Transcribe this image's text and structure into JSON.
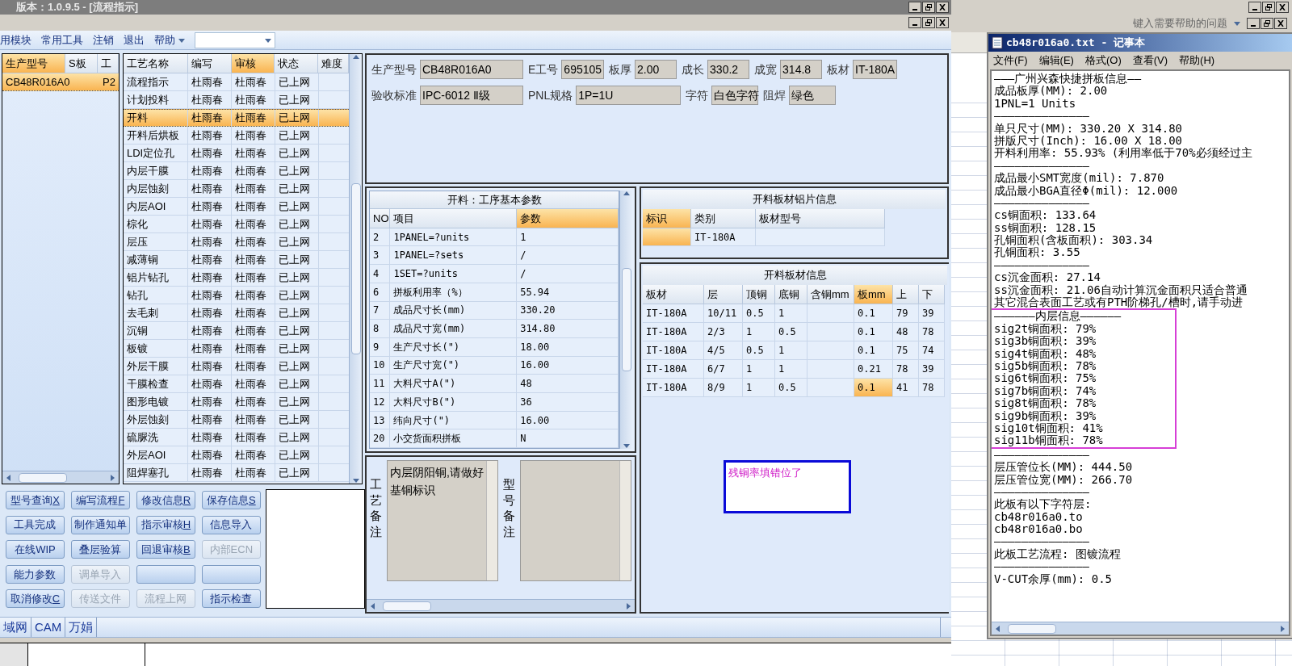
{
  "window": {
    "title": "版本：1.0.9.5 - [流程指示]"
  },
  "menu": [
    {
      "label": "用模块",
      "kind": "item"
    },
    {
      "label": "常用工具",
      "kind": "item"
    },
    {
      "label": "注销",
      "kind": "item"
    },
    {
      "label": "退出",
      "kind": "item"
    },
    {
      "label": "帮助",
      "kind": "dropdown"
    }
  ],
  "model_list": {
    "columns": [
      {
        "label": "生产型号",
        "selected": true
      },
      {
        "label": "S板",
        "selected": false
      },
      {
        "label": "工",
        "selected": false
      }
    ],
    "rows": [
      {
        "cells": [
          "CB48R016A0",
          "",
          "P2"
        ],
        "selected": true
      }
    ]
  },
  "process_table": {
    "columns": [
      {
        "label": "工艺名称",
        "selected": false
      },
      {
        "label": "编写",
        "selected": false
      },
      {
        "label": "审核",
        "selected": true
      },
      {
        "label": "状态",
        "selected": false
      },
      {
        "label": "难度",
        "selected": false
      }
    ],
    "rows": [
      {
        "cells": [
          "流程指示",
          "杜雨春",
          "杜雨春",
          "已上网"
        ],
        "selected": false
      },
      {
        "cells": [
          "计划投料",
          "杜雨春",
          "杜雨春",
          "已上网"
        ],
        "selected": false
      },
      {
        "cells": [
          "开料",
          "杜雨春",
          "杜雨春",
          "已上网"
        ],
        "selected": true
      },
      {
        "cells": [
          "开料后烘板",
          "杜雨春",
          "杜雨春",
          "已上网"
        ],
        "selected": false
      },
      {
        "cells": [
          "LDI定位孔",
          "杜雨春",
          "杜雨春",
          "已上网"
        ],
        "selected": false
      },
      {
        "cells": [
          "内层干膜",
          "杜雨春",
          "杜雨春",
          "已上网"
        ],
        "selected": false
      },
      {
        "cells": [
          "内层蚀刻",
          "杜雨春",
          "杜雨春",
          "已上网"
        ],
        "selected": false
      },
      {
        "cells": [
          "内层AOI",
          "杜雨春",
          "杜雨春",
          "已上网"
        ],
        "selected": false
      },
      {
        "cells": [
          "棕化",
          "杜雨春",
          "杜雨春",
          "已上网"
        ],
        "selected": false
      },
      {
        "cells": [
          "层压",
          "杜雨春",
          "杜雨春",
          "已上网"
        ],
        "selected": false
      },
      {
        "cells": [
          "减薄铜",
          "杜雨春",
          "杜雨春",
          "已上网"
        ],
        "selected": false
      },
      {
        "cells": [
          "铝片钻孔",
          "杜雨春",
          "杜雨春",
          "已上网"
        ],
        "selected": false
      },
      {
        "cells": [
          "钻孔",
          "杜雨春",
          "杜雨春",
          "已上网"
        ],
        "selected": false
      },
      {
        "cells": [
          "去毛刺",
          "杜雨春",
          "杜雨春",
          "已上网"
        ],
        "selected": false
      },
      {
        "cells": [
          "沉铜",
          "杜雨春",
          "杜雨春",
          "已上网"
        ],
        "selected": false
      },
      {
        "cells": [
          "板镀",
          "杜雨春",
          "杜雨春",
          "已上网"
        ],
        "selected": false
      },
      {
        "cells": [
          "外层干膜",
          "杜雨春",
          "杜雨春",
          "已上网"
        ],
        "selected": false
      },
      {
        "cells": [
          "干膜检查",
          "杜雨春",
          "杜雨春",
          "已上网"
        ],
        "selected": false
      },
      {
        "cells": [
          "图形电镀",
          "杜雨春",
          "杜雨春",
          "已上网"
        ],
        "selected": false
      },
      {
        "cells": [
          "外层蚀刻",
          "杜雨春",
          "杜雨春",
          "已上网"
        ],
        "selected": false
      },
      {
        "cells": [
          "硫脲洗",
          "杜雨春",
          "杜雨春",
          "已上网"
        ],
        "selected": false
      },
      {
        "cells": [
          "外层AOI",
          "杜雨春",
          "杜雨春",
          "已上网"
        ],
        "selected": false
      },
      {
        "cells": [
          "阻焊塞孔",
          "杜雨春",
          "杜雨春",
          "已上网"
        ],
        "selected": false
      }
    ]
  },
  "info": {
    "fields_top": [
      {
        "label": "生产型号",
        "value": "CB48R016A0"
      },
      {
        "label": "E工号",
        "value": "695105"
      },
      {
        "label": "板厚",
        "value": "2.00"
      },
      {
        "label": "成长",
        "value": "330.2"
      },
      {
        "label": "成宽",
        "value": "314.8"
      },
      {
        "label": "板材",
        "value": "IT-180A"
      }
    ],
    "fields_bottom": [
      {
        "label": "验收标准",
        "value": "IPC-6012 Ⅱ级"
      },
      {
        "label": "PNL规格",
        "value": "1P=1U"
      },
      {
        "label": "字符",
        "value": "白色字符"
      },
      {
        "label": "阻焊",
        "value": "绿色"
      }
    ]
  },
  "params": {
    "title": "开料：工序基本参数",
    "columns": [
      {
        "label": "NO",
        "selected": false
      },
      {
        "label": "项目",
        "selected": false
      },
      {
        "label": "参数",
        "selected": true
      }
    ],
    "rows": [
      [
        "2",
        "1PANEL=?units",
        "1"
      ],
      [
        "3",
        "1PANEL=?sets",
        "/"
      ],
      [
        "4",
        "1SET=?units",
        "/"
      ],
      [
        "6",
        "拼板利用率（%）",
        "55.94"
      ],
      [
        "7",
        "成品尺寸长(mm)",
        "330.20"
      ],
      [
        "8",
        "成品尺寸宽(mm)",
        "314.80"
      ],
      [
        "9",
        "生产尺寸长(\")",
        "18.00"
      ],
      [
        "10",
        "生产尺寸宽(\")",
        "16.00"
      ],
      [
        "11",
        "大料尺寸A(\")",
        "48"
      ],
      [
        "12",
        "大料尺寸B(\")",
        "36"
      ],
      [
        "13",
        "纬向尺寸(\")",
        "16.00"
      ],
      [
        "20",
        "小交货面积拼板",
        "N"
      ]
    ]
  },
  "remarks": [
    {
      "label": "工艺备注",
      "value": "内层阴阳铜,请做好基铜标识"
    },
    {
      "label": "型号备注"
    }
  ],
  "foil_info": {
    "title": "开料板材铝片信息",
    "columns": [
      {
        "label": "标识",
        "selected": true
      },
      {
        "label": "类别",
        "selected": false
      },
      {
        "label": "板材型号",
        "selected": false
      }
    ],
    "rows": [
      [
        {
          "selected": true
        },
        {
          "text": "IT-180A",
          "selected": false
        },
        {
          "selected": false
        }
      ]
    ]
  },
  "board_info": {
    "title": "开料板材信息",
    "columns": [
      {
        "label": "板材",
        "selected": false
      },
      {
        "label": "层",
        "selected": false
      },
      {
        "label": "顶铜",
        "selected": false
      },
      {
        "label": "底铜",
        "selected": false
      },
      {
        "label": "含铜mm",
        "selected": false
      },
      {
        "label": "板mm",
        "selected": true
      },
      {
        "label": "上",
        "selected": false
      },
      {
        "label": "下",
        "selected": false
      }
    ],
    "rows": [
      [
        {
          "text": "IT-180A",
          "selected": false
        },
        {
          "text": "10/11",
          "selected": false
        },
        {
          "text": "0.5",
          "selected": false
        },
        {
          "text": "1",
          "selected": false
        },
        {
          "selected": false
        },
        {
          "text": "0.1",
          "selected": false
        },
        {
          "text": "79",
          "selected": false
        },
        {
          "text": "39",
          "selected": false
        }
      ],
      [
        {
          "text": "IT-180A",
          "selected": false
        },
        {
          "text": "2/3",
          "selected": false
        },
        {
          "text": "1",
          "selected": false
        },
        {
          "text": "0.5",
          "selected": false
        },
        {
          "selected": false
        },
        {
          "text": "0.1",
          "selected": false
        },
        {
          "text": "48",
          "selected": false
        },
        {
          "text": "78",
          "selected": false
        }
      ],
      [
        {
          "text": "IT-180A",
          "selected": false
        },
        {
          "text": "4/5",
          "selected": false
        },
        {
          "text": "0.5",
          "selected": false
        },
        {
          "text": "1",
          "selected": false
        },
        {
          "selected": false
        },
        {
          "text": "0.1",
          "selected": false
        },
        {
          "text": "75",
          "selected": false
        },
        {
          "text": "74",
          "selected": false
        }
      ],
      [
        {
          "text": "IT-180A",
          "selected": false
        },
        {
          "text": "6/7",
          "selected": false
        },
        {
          "text": "1",
          "selected": false
        },
        {
          "text": "1",
          "selected": false
        },
        {
          "selected": false
        },
        {
          "text": "0.21",
          "selected": false
        },
        {
          "text": "78",
          "selected": false
        },
        {
          "text": "39",
          "selected": false
        }
      ],
      [
        {
          "text": "IT-180A",
          "selected": false
        },
        {
          "text": "8/9",
          "selected": false
        },
        {
          "text": "1",
          "selected": false
        },
        {
          "text": "0.5",
          "selected": false
        },
        {
          "selected": false
        },
        {
          "text": "0.1",
          "selected": true
        },
        {
          "text": "41",
          "selected": false
        },
        {
          "text": "78",
          "selected": false
        }
      ]
    ]
  },
  "annotation_note": {
    "text": "残铜率填错位了"
  },
  "buttons": [
    {
      "label": "型号查询",
      "key": "X",
      "disabled": false
    },
    {
      "label": "编写流程",
      "key": "F",
      "disabled": false
    },
    {
      "label": "修改信息",
      "key": "R",
      "disabled": false
    },
    {
      "label": "保存信息",
      "key": "S",
      "disabled": false
    },
    {
      "label": "工具完成",
      "disabled": false
    },
    {
      "label": "制作通知单",
      "disabled": false
    },
    {
      "label": "指示审核",
      "key": "H",
      "disabled": false
    },
    {
      "label": "信息导入",
      "disabled": false
    },
    {
      "label": "在线WIP",
      "disabled": false
    },
    {
      "label": "叠层验算",
      "disabled": false
    },
    {
      "label": "回退审核",
      "key": "B",
      "disabled": false
    },
    {
      "label": "内部ECN",
      "disabled": true
    },
    {
      "label": "能力参数",
      "disabled": false
    },
    {
      "label": "调单导入",
      "disabled": true
    },
    {
      "disabled": false
    },
    {
      "disabled": false
    },
    {
      "label": "取消修改",
      "key": "C",
      "disabled": false
    },
    {
      "label": "传送文件",
      "disabled": true
    },
    {
      "label": "流程上网",
      "disabled": true
    },
    {
      "label": "指示检查",
      "disabled": false
    }
  ],
  "status_tabs": [
    {
      "label": "域网"
    },
    {
      "label": "CAM"
    },
    {
      "label": "万娟"
    }
  ],
  "excel": {
    "help_placeholder": "键入需要帮助的问题"
  },
  "notepad": {
    "title": "cb48r016a0.txt - 记事本",
    "menu": [
      "文件(F)",
      "编辑(E)",
      "格式(O)",
      "查看(V)",
      "帮助(H)"
    ],
    "lines_before": [
      "———广州兴森快捷拼板信息——",
      "成品板厚(MM): 2.00",
      "1PNL=1 Units",
      "——————————————",
      "单只尺寸(MM): 330.20 X 314.80",
      "拼版尺寸(Inch): 16.00 X 18.00",
      "开料利用率: 55.93% (利用率低于70%必须经过主",
      "——————————————",
      "成品最小SMT宽度(mil): 7.870",
      "成品最小BGA直径Φ(mil):  12.000",
      "——————————————",
      "cs铜面积: 133.64",
      "ss铜面积: 128.15",
      "孔铜面积(含板面积): 303.34",
      "孔铜面积: 3.55",
      "——————————————",
      "cs沉金面积: 27.14",
      "ss沉金面积: 21.06自动计算沉金面积只适合普通",
      "其它混合表面工艺或有PTH阶梯孔/槽时,请手动进"
    ],
    "boxed_lines": [
      "——————内层信息——————",
      "sig2t铜面积: 79%",
      "sig3b铜面积: 39%",
      "sig4t铜面积: 48%",
      "sig5b铜面积: 78%",
      "sig6t铜面积: 75%",
      "sig7b铜面积: 74%",
      "sig8t铜面积: 78%",
      "sig9b铜面积: 39%",
      "sig10t铜面积: 41%",
      "sig11b铜面积: 78%"
    ],
    "lines_after": [
      "——————————————",
      "层压管位长(MM): 444.50",
      "层压管位宽(MM): 266.70",
      "——————————————",
      "此板有以下字符层:",
      "cb48r016a0.to",
      "cb48r016a0.bo",
      "——————————————",
      "此板工艺流程: 图镀流程",
      "——————————————",
      "V-CUT余厚(mm): 0.5"
    ]
  }
}
